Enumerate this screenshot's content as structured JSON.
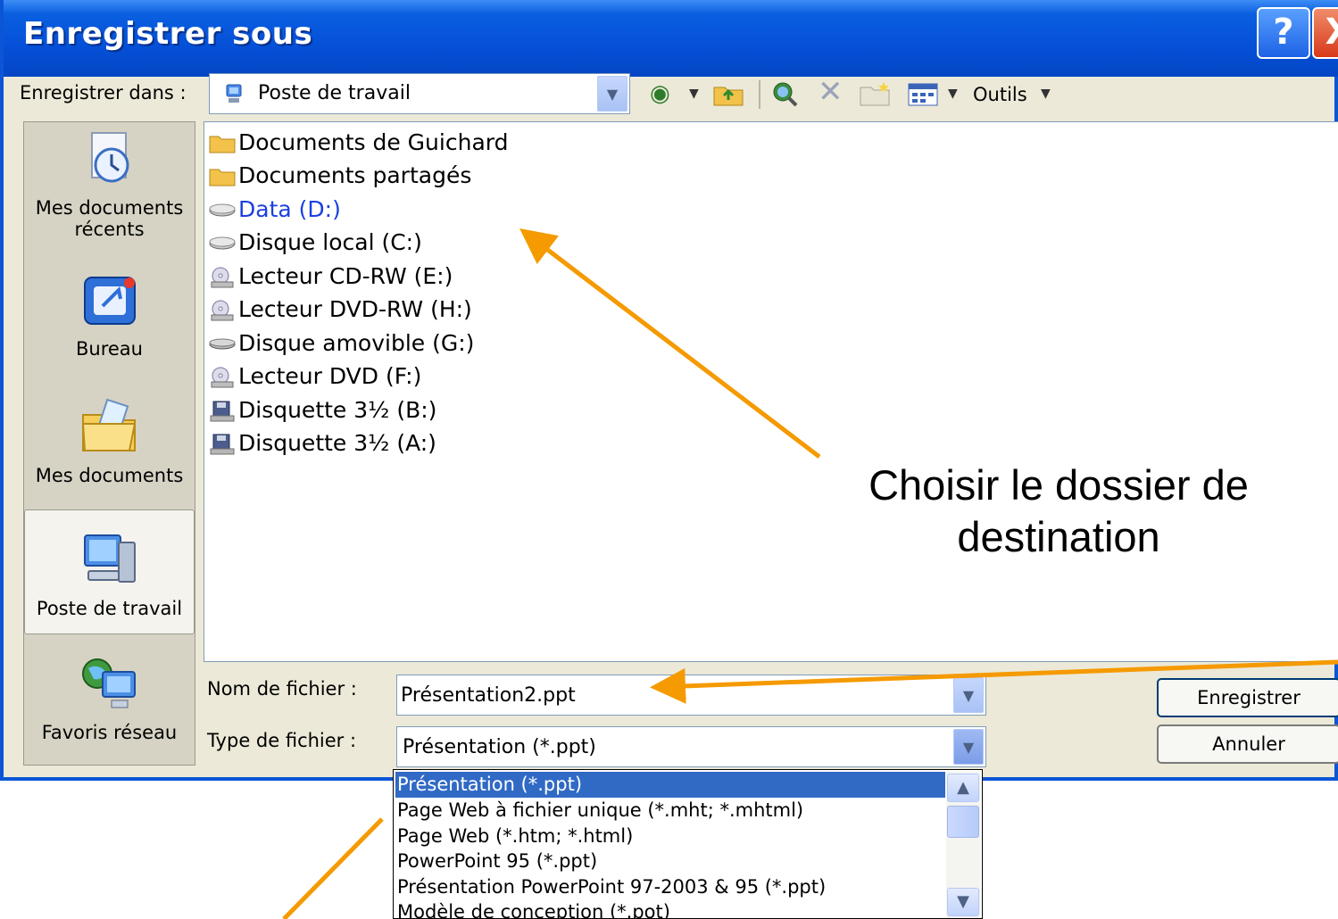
{
  "window": {
    "title": "Enregistrer sous",
    "help_label": "?",
    "close_label": "X"
  },
  "toolbar": {
    "save_in_label": "Enregistrer dans :",
    "location_value": "Poste de travail",
    "tools_label": "Outils",
    "icons": [
      "back-icon",
      "up-folder-icon",
      "search-web-icon",
      "delete-icon",
      "new-folder-icon",
      "views-icon"
    ]
  },
  "places": [
    {
      "label": "Mes documents récents",
      "icon": "recent-documents-icon"
    },
    {
      "label": "Bureau",
      "icon": "desktop-icon"
    },
    {
      "label": "Mes documents",
      "icon": "my-documents-icon"
    },
    {
      "label": "Poste de travail",
      "icon": "my-computer-icon",
      "active": true
    },
    {
      "label": "Favoris réseau",
      "icon": "network-places-icon"
    }
  ],
  "files": [
    {
      "label": "Documents de Guichard",
      "icon": "folder-icon"
    },
    {
      "label": "Documents partagés",
      "icon": "folder-icon"
    },
    {
      "label": "Data (D:)",
      "icon": "hard-drive-icon",
      "selected": true
    },
    {
      "label": "Disque local (C:)",
      "icon": "hard-drive-icon"
    },
    {
      "label": "Lecteur CD-RW (E:)",
      "icon": "cd-drive-icon"
    },
    {
      "label": "Lecteur DVD-RW (H:)",
      "icon": "cd-drive-icon"
    },
    {
      "label": "Disque amovible (G:)",
      "icon": "removable-drive-icon"
    },
    {
      "label": "Lecteur DVD (F:)",
      "icon": "cd-drive-icon"
    },
    {
      "label": "Disquette 3½ (B:)",
      "icon": "floppy-icon"
    },
    {
      "label": "Disquette 3½ (A:)",
      "icon": "floppy-icon"
    }
  ],
  "form": {
    "filename_label": "Nom de fichier :",
    "filename_value": "Présentation2.ppt",
    "filetype_label": "Type de fichier :",
    "filetype_value": "Présentation (*.ppt)",
    "save_button": "Enregistrer",
    "cancel_button": "Annuler"
  },
  "filetype_options": [
    {
      "label": "Présentation (*.ppt)",
      "selected": true
    },
    {
      "label": "Page Web à fichier unique (*.mht; *.mhtml)"
    },
    {
      "label": "Page Web (*.htm; *.html)"
    },
    {
      "label": "PowerPoint 95 (*.ppt)"
    },
    {
      "label": "Présentation PowerPoint 97-2003 & 95 (*.ppt)"
    },
    {
      "label": "Modèle de conception (*.pot)"
    }
  ],
  "annotation": {
    "line1": "Choisir le dossier de",
    "line2": "destination"
  },
  "colors": {
    "titlebar": "#0550d8",
    "arrow": "#f59a00",
    "selection": "#316ac5",
    "selected_drive_text": "#1a3fe0"
  }
}
